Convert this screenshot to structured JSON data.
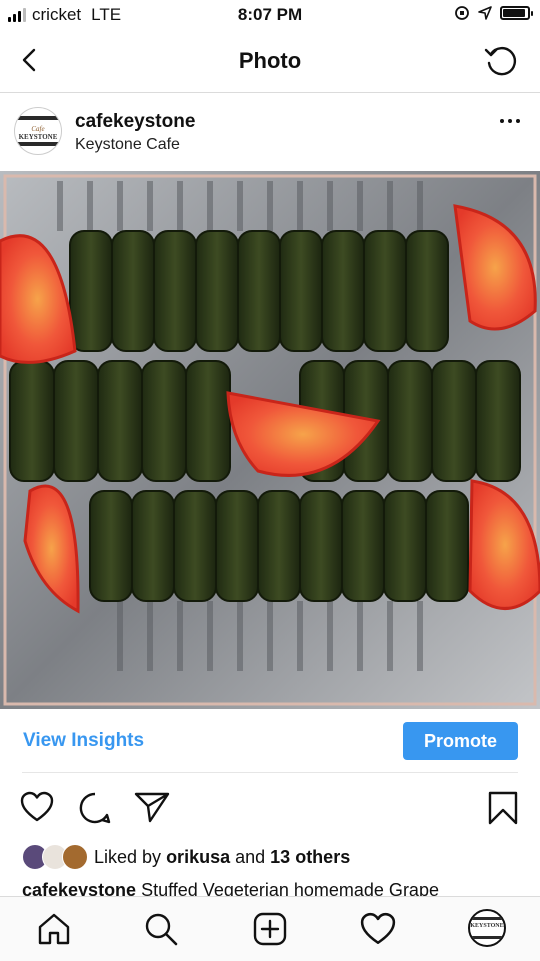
{
  "status_bar": {
    "carrier": "cricket",
    "network": "LTE",
    "time": "8:07 PM",
    "battery_level": 0.9
  },
  "nav": {
    "title": "Photo"
  },
  "post": {
    "username": "cafekeystone",
    "location": "Keystone Cafe",
    "avatar_logo_text": "KEYSTONE",
    "avatar_logo_script": "Cafe"
  },
  "insights": {
    "view_label": "View Insights",
    "promote_label": "Promote"
  },
  "likes": {
    "prefix": "Liked by",
    "user": "orikusa",
    "conjunction": "and",
    "others": "13 others"
  },
  "caption": {
    "username": "cafekeystone",
    "text": "Stuffed Vegeterian homemade Grape"
  },
  "colors": {
    "accent": "#3897f0",
    "divider": "#dbdbdb"
  },
  "icons": {
    "back": "chevron-left-icon",
    "refresh": "refresh-icon",
    "more": "more-horizontal-icon",
    "like": "heart-icon",
    "comment": "comment-icon",
    "share": "send-icon",
    "save": "bookmark-icon",
    "home": "home-icon",
    "search": "search-icon",
    "new_post": "add-post-icon",
    "activity": "heart-icon",
    "profile": "profile-avatar"
  }
}
